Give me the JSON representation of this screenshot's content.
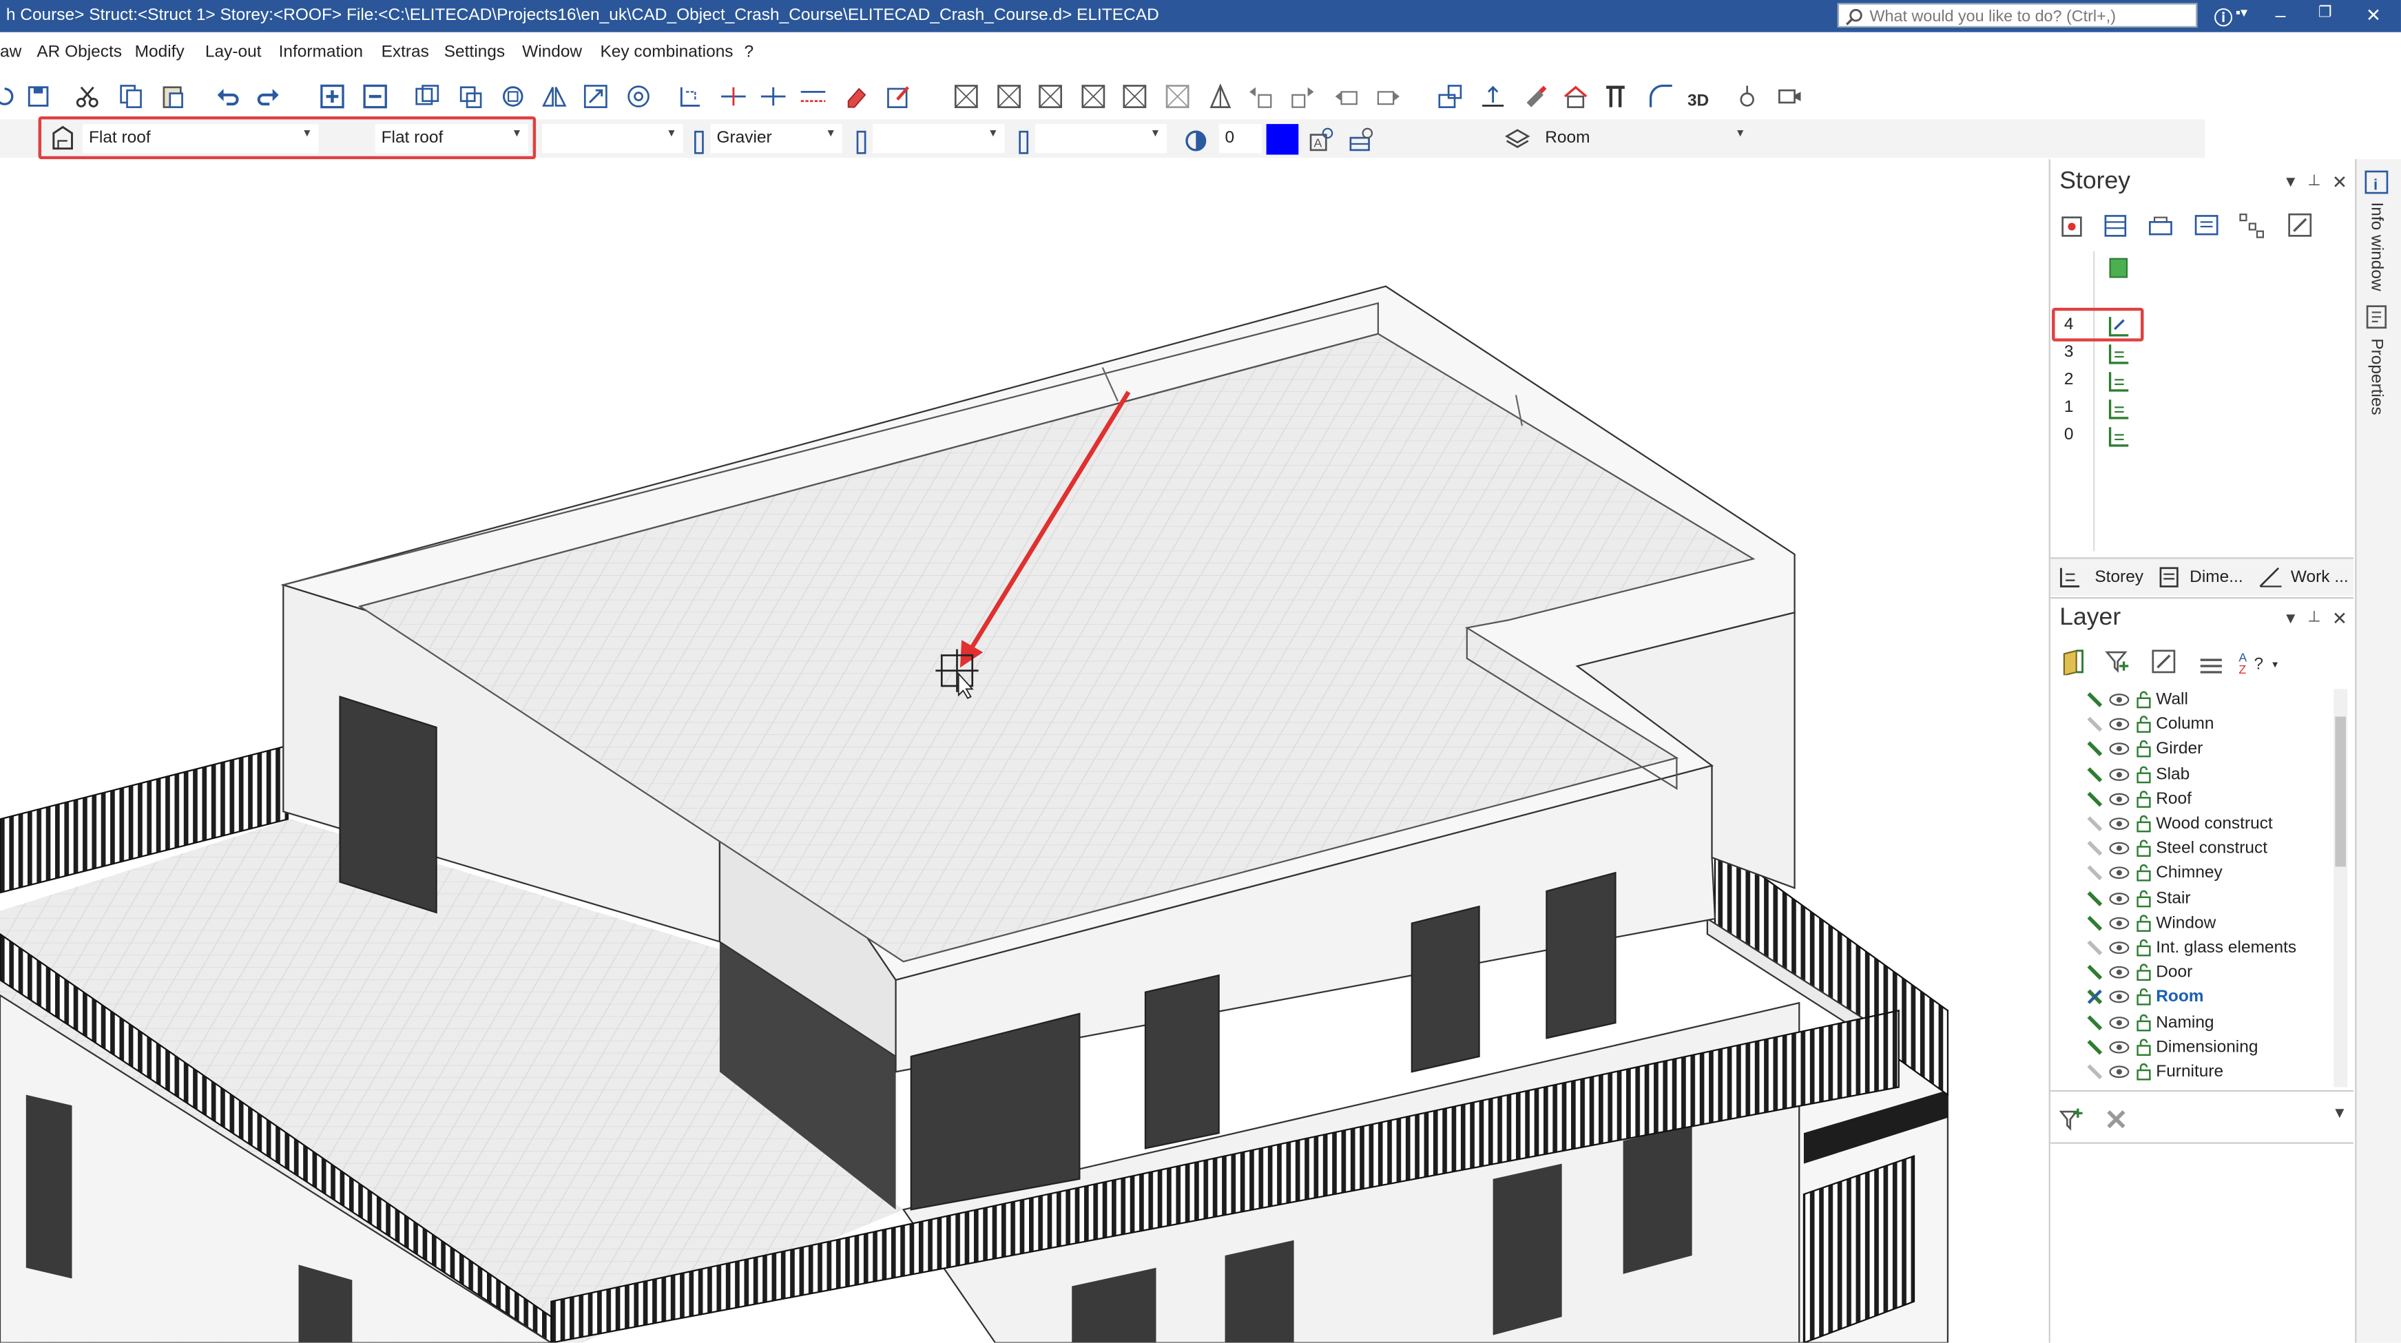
{
  "titlebar": {
    "title": "h Course> Struct:<Struct 1>  Storey:<ROOF>  File:<C:\\ELITECAD\\Projects16\\en_uk\\CAD_Object_Crash_Course\\ELITECAD_Crash_Course.d>  ELITECAD",
    "search_placeholder": "What would you like to do? (Ctrl+,)"
  },
  "menu": {
    "items": [
      "aw",
      "AR Objects",
      "Modify",
      "Lay-out",
      "Information",
      "Extras",
      "Settings",
      "Window",
      "Key combinations",
      "?"
    ]
  },
  "propbar": {
    "type_value": "Flat roof",
    "type2_value": "Flat roof",
    "material_value": "Gravier",
    "number_value": "0",
    "layer_value": "Room",
    "color_hex": "#0000ff"
  },
  "storey_panel": {
    "title": "Storey",
    "storeys": [
      "4",
      "3",
      "2",
      "1",
      "0"
    ],
    "tabs": [
      "Storey",
      "Dime...",
      "Work ..."
    ]
  },
  "layer_panel": {
    "title": "Layer",
    "layers": [
      "Wall",
      "Column",
      "Girder",
      "Slab",
      "Roof",
      "Wood construct",
      "Steel construct",
      "Chimney",
      "Stair",
      "Window",
      "Int. glass elements",
      "Door",
      "Room",
      "Naming",
      "Dimensioning",
      "Furniture"
    ],
    "active_layer": "Room"
  },
  "side_strip": {
    "info": "Info window",
    "properties": "Properties"
  },
  "colors": {
    "title_bar": "#2b579a",
    "highlight": "#e04040",
    "active_layer": "#1a5fb4",
    "arrow": "#e03030"
  }
}
